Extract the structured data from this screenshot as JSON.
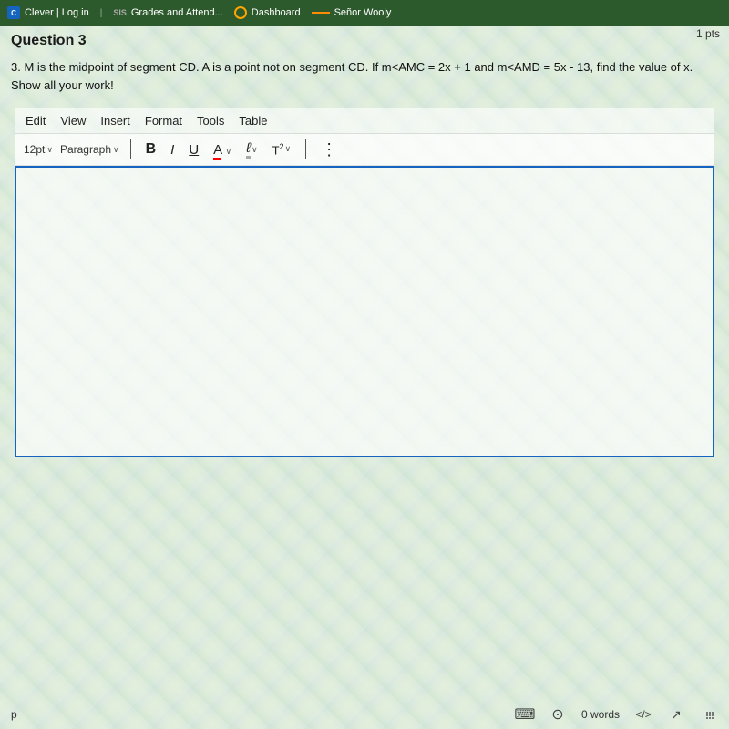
{
  "browser": {
    "tabs": [
      {
        "label": "Clever | Log in",
        "type": "clever"
      },
      {
        "label": "Grades and Attend...",
        "type": "sis"
      },
      {
        "label": "Dashboard",
        "type": "circle"
      },
      {
        "label": "Señor Wooly",
        "type": "dash"
      }
    ]
  },
  "page": {
    "pts": "1 pts",
    "question_label": "Question 3",
    "question_text": "3.  M is the midpoint of segment CD.  A is a point not on segment CD.  If m<AMC = 2x + 1 and m<AMD = 5x - 13, find the value of x.  Show all your work!"
  },
  "editor": {
    "menu": {
      "items": [
        "Edit",
        "View",
        "Insert",
        "Format",
        "Tools",
        "Table"
      ]
    },
    "toolbar": {
      "font_size": "12pt",
      "font_size_chevron": "∨",
      "paragraph": "Paragraph",
      "paragraph_chevron": "∨",
      "bold_label": "B",
      "italic_label": "I",
      "underline_label": "U",
      "font_color_label": "A",
      "highlight_label": "ℓ",
      "superscript_label": "T²",
      "more_label": "⋮"
    },
    "content": "",
    "word_count": "0 words"
  },
  "statusbar": {
    "paragraph_marker": "p",
    "word_count": "0 words",
    "code_label": "</>",
    "expand_icon": "↗",
    "more_icon": "⋮"
  }
}
